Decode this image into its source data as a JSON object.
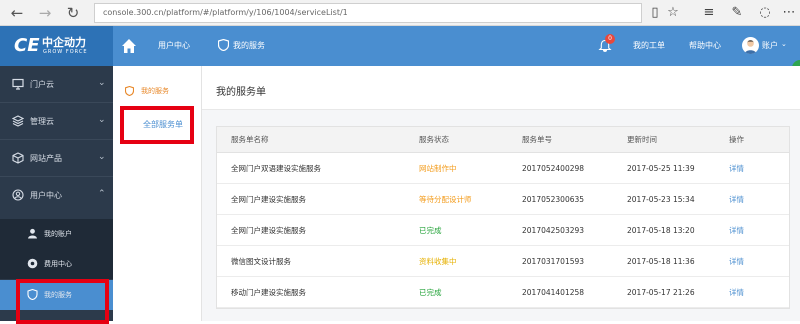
{
  "browser": {
    "url": "console.300.cn/platform/#/platform/y/106/1004/serviceList/1"
  },
  "header": {
    "logo_cn": "中企动力",
    "logo_en": "GROW FORCE",
    "logo_mark": "CE",
    "breadcrumb_user_center": "用户中心",
    "breadcrumb_my_services": "我的服务",
    "notification_count": "0",
    "my_tickets": "我的工单",
    "help_center": "帮助中心",
    "account": "账户",
    "accent_color": "#4a8ed0"
  },
  "sidebar": {
    "items": [
      {
        "label": "门户云",
        "icon": "monitor-icon"
      },
      {
        "label": "管理云",
        "icon": "layers-icon"
      },
      {
        "label": "网站产品",
        "icon": "cube-icon"
      },
      {
        "label": "用户中心",
        "icon": "user-circle-icon"
      }
    ],
    "sub_items": [
      {
        "label": "我的账户",
        "icon": "person-icon"
      },
      {
        "label": "费用中心",
        "icon": "coin-icon"
      },
      {
        "label": "我的服务",
        "icon": "shield-icon"
      }
    ]
  },
  "subnav": {
    "heading": "我的服务",
    "link": "全部服务单"
  },
  "main": {
    "title": "我的服务单",
    "columns": [
      "服务单名称",
      "服务状态",
      "服务单号",
      "更新时间",
      "操作"
    ],
    "rows": [
      {
        "name": "全网门户双语建设实施服务",
        "status": "网站制作中",
        "status_color": "orange",
        "number": "2017052400298",
        "updated": "2017-05-25 11:39",
        "action": "详情"
      },
      {
        "name": "全网门户建设实施服务",
        "status": "等待分配设计师",
        "status_color": "orange",
        "number": "2017052300635",
        "updated": "2017-05-23 15:34",
        "action": "详情"
      },
      {
        "name": "全网门户建设实施服务",
        "status": "已完成",
        "status_color": "green",
        "number": "2017042503293",
        "updated": "2017-05-18 13:20",
        "action": "详情"
      },
      {
        "name": "微信图文设计服务",
        "status": "资料收集中",
        "status_color": "yellow",
        "number": "2017031701593",
        "updated": "2017-05-18 11:36",
        "action": "详情"
      },
      {
        "name": "移动门户建设实施服务",
        "status": "已完成",
        "status_color": "green",
        "number": "2017041401258",
        "updated": "2017-05-17 21:26",
        "action": "详情"
      }
    ]
  }
}
